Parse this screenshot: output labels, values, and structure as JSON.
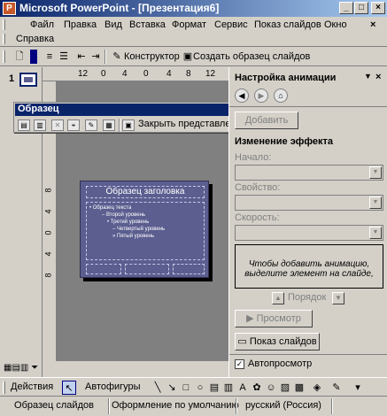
{
  "window": {
    "title": "Microsoft PowerPoint - [Презентация6]",
    "app_icon": "P",
    "controls": [
      "_",
      "□",
      "×"
    ]
  },
  "menu": {
    "items": [
      "Файл",
      "Правка",
      "Вид",
      "Вставка",
      "Формат",
      "Сервис",
      "Показ слайдов",
      "Окно",
      "Справка"
    ],
    "close_doc": "×"
  },
  "toolbar": {
    "constructor_label": "Конструктор",
    "create_master_label": "Создать образец слайдов"
  },
  "leftpane": {
    "slide_number": "1"
  },
  "ruler": {
    "top_marks": [
      "12",
      "0",
      "4",
      "0",
      "4",
      "8",
      "12"
    ],
    "left_marks": [
      "8",
      "4",
      "0",
      "4",
      "8"
    ]
  },
  "slide": {
    "title": "Образец заголовка",
    "body_lines": [
      "• Образец текста",
      "– Второй уровень",
      "• Третий уровень",
      "– Четвертый уровень",
      "» Пятый уровень"
    ]
  },
  "master_toolbar": {
    "title": "Образец",
    "close_view_label": "Закрыть представление мастера"
  },
  "taskpane": {
    "title": "Настройка анимации",
    "add_effect_button": "Добавить",
    "change_effect_section": "Изменение эффекта",
    "start_label": "Начало:",
    "property_label": "Свойство:",
    "speed_label": "Скорость:",
    "hint_text": "Чтобы добавить анимацию, выделите элемент на слайде,",
    "order_label": "Порядок",
    "preview_button": "Просмотр",
    "slideshow_button": "Показ слайдов",
    "autopreview_label": "Автопросмотр",
    "autopreview_checked": true
  },
  "drawbar": {
    "actions_label": "Действия",
    "autoshapes_label": "Автофигуры"
  },
  "statusbar": {
    "view": "Образец слайдов",
    "design": "Оформление по умолчанию",
    "language": "русский (Россия)"
  }
}
